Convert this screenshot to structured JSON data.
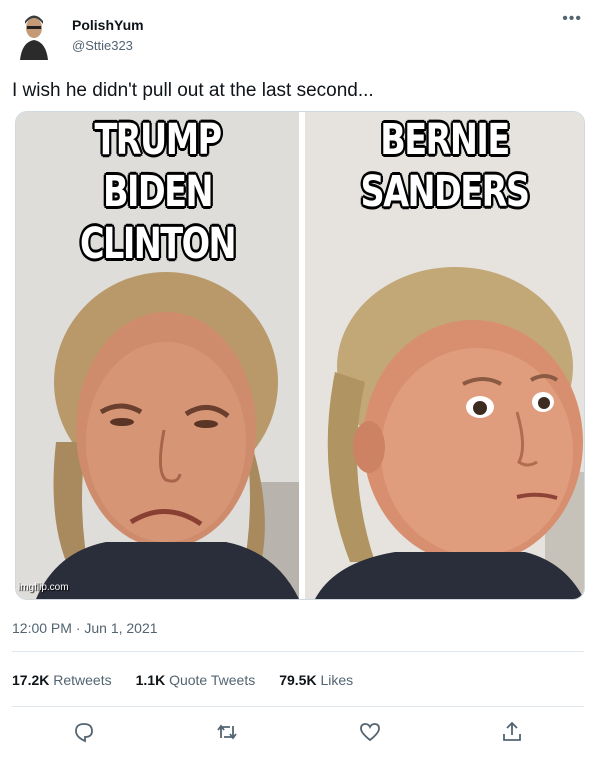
{
  "user": {
    "display_name": "PolishYum",
    "handle": "@Sttie323"
  },
  "tweet": {
    "text": "I wish he didn't pull out at the last second..."
  },
  "meme": {
    "left_caption": [
      "TRUMP",
      "BIDEN",
      "CLINTON"
    ],
    "right_caption": [
      "BERNIE",
      "SANDERS"
    ],
    "watermark": "imgflip.com"
  },
  "timestamp": "12:00 PM · Jun 1, 2021",
  "stats": {
    "retweets_count": "17.2K",
    "retweets_label": "Retweets",
    "quotes_count": "1.1K",
    "quotes_label": "Quote Tweets",
    "likes_count": "79.5K",
    "likes_label": "Likes"
  },
  "icons": {
    "more": "more-icon",
    "reply": "reply-icon",
    "retweet": "retweet-icon",
    "like": "heart-icon",
    "share": "share-icon"
  },
  "colors": {
    "secondary_text": "#536471",
    "primary_text": "#0f1419",
    "divider": "#e1e8ed"
  }
}
